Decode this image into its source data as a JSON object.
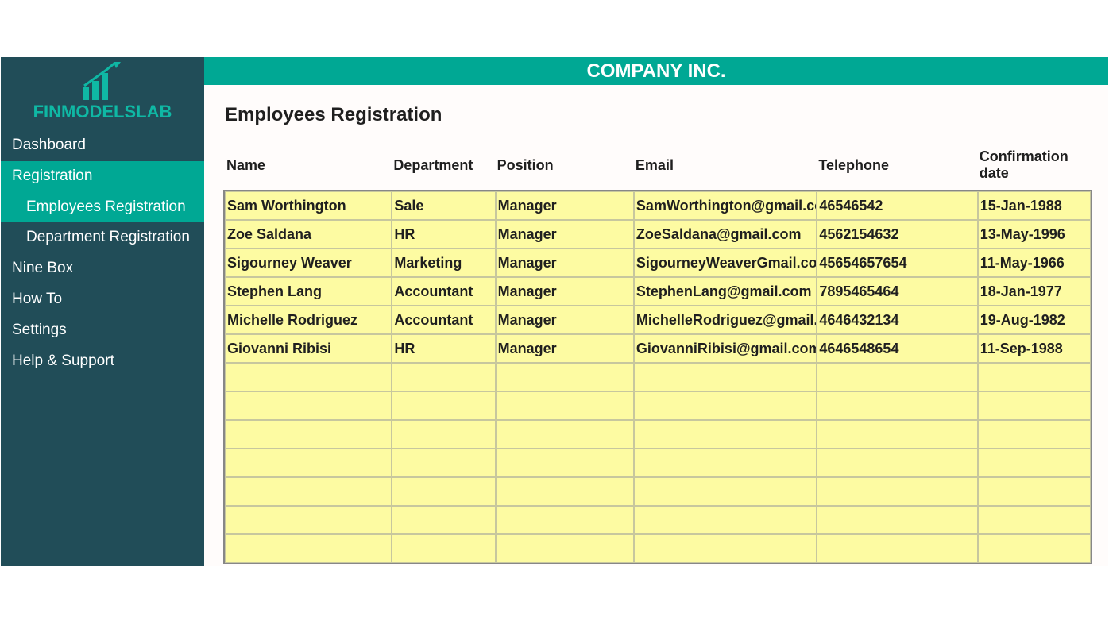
{
  "company_name": "COMPANY INC.",
  "logo_text": "FINMODELSLAB",
  "page_title": "Employees Registration",
  "sidebar": {
    "items": [
      {
        "label": "Dashboard",
        "active": false,
        "sub": false
      },
      {
        "label": "Registration",
        "active": true,
        "sub": false
      },
      {
        "label": "Employees Registration",
        "active": true,
        "sub": true
      },
      {
        "label": "Department Registration",
        "active": false,
        "sub": true
      },
      {
        "label": "Nine Box",
        "active": false,
        "sub": false
      },
      {
        "label": "How To",
        "active": false,
        "sub": false
      },
      {
        "label": "Settings",
        "active": false,
        "sub": false
      },
      {
        "label": "Help & Support",
        "active": false,
        "sub": false
      }
    ]
  },
  "table": {
    "headers": [
      "Name",
      "Department",
      "Position",
      "Email",
      "Telephone",
      "Confirmation date"
    ],
    "rows": [
      {
        "name": "Sam Worthington",
        "department": "Sale",
        "position": "Manager",
        "email": "SamWorthington@gmail.com",
        "telephone": "46546542",
        "confirmation": "15-Jan-1988"
      },
      {
        "name": "Zoe Saldana",
        "department": "HR",
        "position": "Manager",
        "email": "ZoeSaldana@gmail.com",
        "telephone": "4562154632",
        "confirmation": "13-May-1996"
      },
      {
        "name": "Sigourney Weaver",
        "department": "Marketing",
        "position": "Manager",
        "email": "SigourneyWeaverGmail.com",
        "telephone": "45654657654",
        "confirmation": "11-May-1966"
      },
      {
        "name": "Stephen Lang",
        "department": "Accountant",
        "position": "Manager",
        "email": "StephenLang@gmail.com",
        "telephone": "7895465464",
        "confirmation": "18-Jan-1977"
      },
      {
        "name": "Michelle Rodriguez",
        "department": "Accountant",
        "position": "Manager",
        "email": "MichelleRodriguez@gmail.com",
        "telephone": "4646432134",
        "confirmation": "19-Aug-1982"
      },
      {
        "name": "Giovanni Ribisi",
        "department": "HR",
        "position": "Manager",
        "email": "GiovanniRibisi@gmail.com",
        "telephone": "4646548654",
        "confirmation": "11-Sep-1988"
      },
      {
        "name": "",
        "department": "",
        "position": "",
        "email": "",
        "telephone": "",
        "confirmation": ""
      },
      {
        "name": "",
        "department": "",
        "position": "",
        "email": "",
        "telephone": "",
        "confirmation": ""
      },
      {
        "name": "",
        "department": "",
        "position": "",
        "email": "",
        "telephone": "",
        "confirmation": ""
      },
      {
        "name": "",
        "department": "",
        "position": "",
        "email": "",
        "telephone": "",
        "confirmation": ""
      },
      {
        "name": "",
        "department": "",
        "position": "",
        "email": "",
        "telephone": "",
        "confirmation": ""
      },
      {
        "name": "",
        "department": "",
        "position": "",
        "email": "",
        "telephone": "",
        "confirmation": ""
      },
      {
        "name": "",
        "department": "",
        "position": "",
        "email": "",
        "telephone": "",
        "confirmation": ""
      }
    ]
  }
}
